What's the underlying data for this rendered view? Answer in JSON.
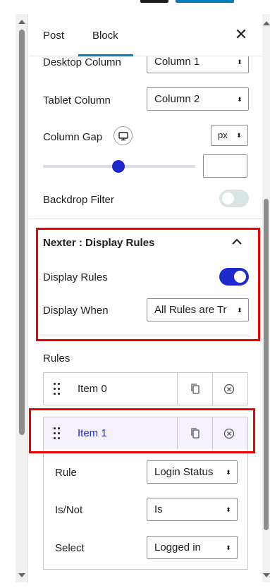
{
  "tabs": {
    "post": "Post",
    "block": "Block",
    "close": "✕"
  },
  "layout_settings": {
    "desktop_column": {
      "label": "Desktop Column",
      "value": "Column 1"
    },
    "tablet_column": {
      "label": "Tablet Column",
      "value": "Column 2"
    },
    "column_gap": {
      "label": "Column Gap",
      "unit": "px",
      "value": ""
    },
    "backdrop_filter": {
      "label": "Backdrop Filter",
      "enabled": false
    }
  },
  "display_rules_section": {
    "title": "Nexter : Display Rules",
    "display_rules": {
      "label": "Display Rules",
      "enabled": true
    },
    "display_when": {
      "label": "Display When",
      "value": "All Rules are Tr"
    }
  },
  "rules": {
    "label": "Rules",
    "items": [
      {
        "label": "Item 0",
        "active": false
      },
      {
        "label": "Item 1",
        "active": true
      }
    ],
    "expanded_item": {
      "rule": {
        "label": "Rule",
        "value": "Login Status"
      },
      "is_not": {
        "label": "Is/Not",
        "value": "Is"
      },
      "select": {
        "label": "Select",
        "value": "Logged in"
      }
    }
  },
  "icons": {
    "caret": "⬍",
    "drag": "drag-handle-icon",
    "copy": "duplicate-icon",
    "remove": "remove-circle-icon",
    "device": "desktop-icon"
  },
  "colors": {
    "accent": "#1d2ad0",
    "tab_indicator": "#007cba",
    "highlight": "#ee0000"
  }
}
